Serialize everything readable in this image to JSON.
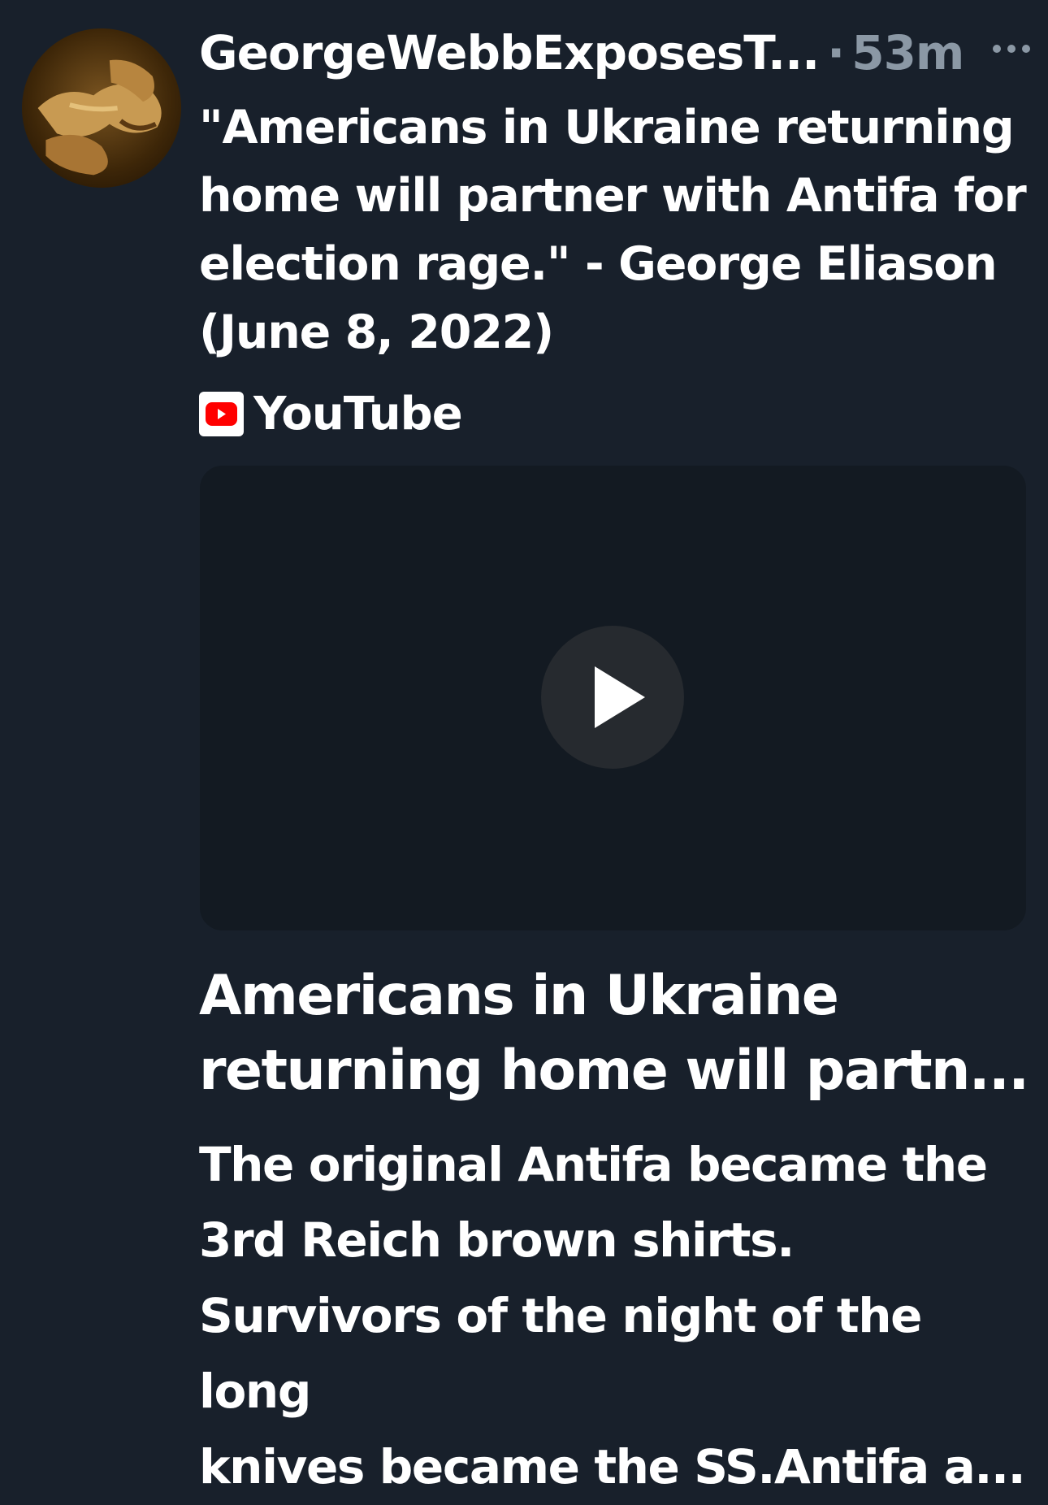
{
  "tweet": {
    "author_display": "GeorgeWebbExposesT...",
    "separator": "·",
    "time": "53m",
    "text_lines": [
      "\"Americans in Ukraine returning",
      "home will partner with Antifa for",
      "election rage.\" - George Eliason",
      "(June 8, 2022)"
    ]
  },
  "link_card": {
    "source_icon": "youtube-icon",
    "source_label": "YouTube",
    "title_lines": [
      "Americans in Ukraine",
      "returning home will partn..."
    ],
    "description_lines": [
      "The original Antifa became the",
      "3rd Reich brown shirts.",
      "Survivors of the night of the long",
      "knives became the SS.Antifa a..."
    ]
  },
  "colors": {
    "background": "#18202b",
    "muted_text": "#8b98a5",
    "video_bg": "#131a22",
    "play_button": "#262a2f",
    "youtube_red": "#ff0000"
  }
}
